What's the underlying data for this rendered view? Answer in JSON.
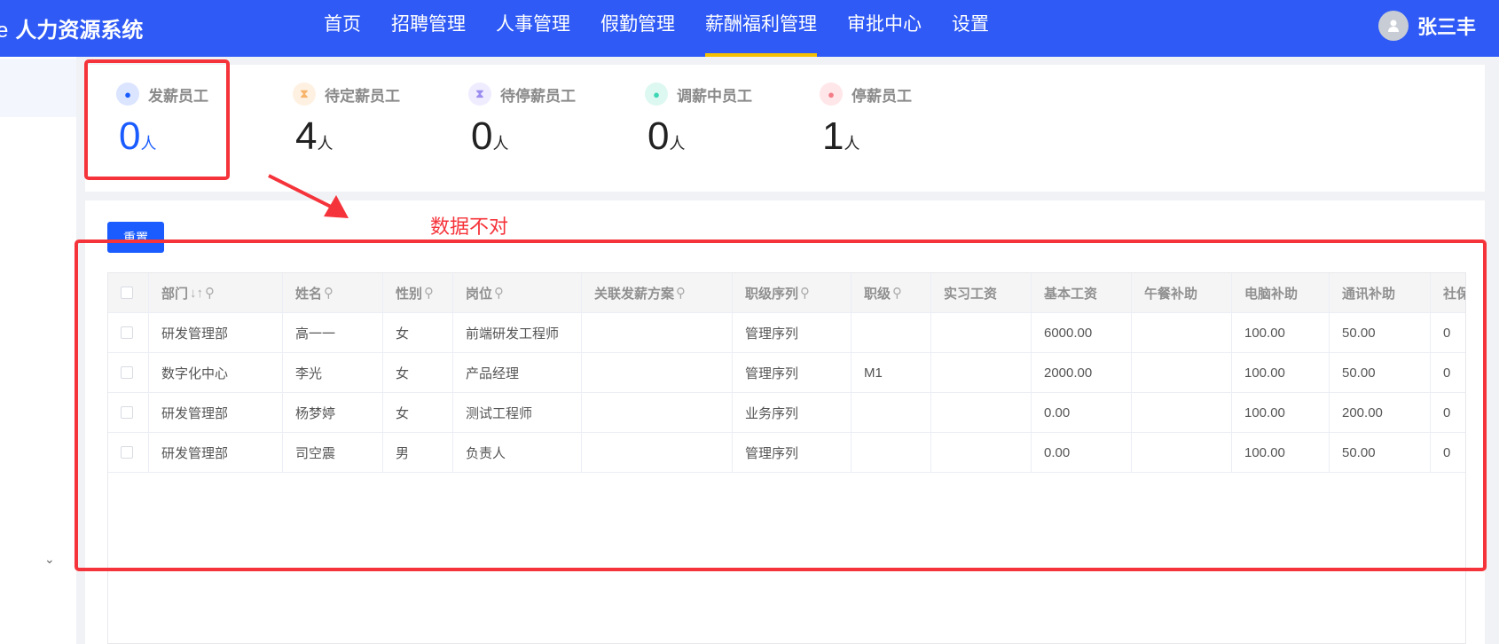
{
  "header": {
    "logo_prefix": "e",
    "title": "人力资源系统",
    "nav": [
      "首页",
      "招聘管理",
      "人事管理",
      "假勤管理",
      "薪酬福利管理",
      "审批中心",
      "设置"
    ],
    "active_nav": "薪酬福利管理",
    "user": "张三丰"
  },
  "stats": [
    {
      "label": "发薪员工",
      "value": "0",
      "unit": "人",
      "icon": "money-bag-icon",
      "color": "#1a5cff",
      "bg": "#dbe5ff"
    },
    {
      "label": "待定薪员工",
      "value": "4",
      "unit": "人",
      "icon": "hourglass-icon",
      "color": "#f7b36a",
      "bg": "#fff1e2"
    },
    {
      "label": "待停薪员工",
      "value": "0",
      "unit": "人",
      "icon": "hourglass-icon",
      "color": "#9b8cf0",
      "bg": "#efecff"
    },
    {
      "label": "调薪中员工",
      "value": "0",
      "unit": "人",
      "icon": "coins-icon",
      "color": "#3dd6b4",
      "bg": "#ddf8f1"
    },
    {
      "label": "停薪员工",
      "value": "1",
      "unit": "人",
      "icon": "money-bag-icon",
      "color": "#f27c88",
      "bg": "#ffe6e9"
    }
  ],
  "toolbar": {
    "reset_label": "重置"
  },
  "annotation": {
    "text": "数据不对"
  },
  "table": {
    "columns": [
      "部门",
      "姓名",
      "性别",
      "岗位",
      "关联发薪方案",
      "职级序列",
      "职级",
      "实习工资",
      "基本工资",
      "午餐补助",
      "电脑补助",
      "通讯补助",
      "社保"
    ],
    "rows": [
      [
        "研发管理部",
        "高一一",
        "女",
        "前端研发工程师",
        "",
        "管理序列",
        "",
        "",
        "6000.00",
        "",
        "100.00",
        "50.00",
        "0"
      ],
      [
        "数字化中心",
        "李光",
        "女",
        "产品经理",
        "",
        "管理序列",
        "M1",
        "",
        "2000.00",
        "",
        "100.00",
        "50.00",
        "0"
      ],
      [
        "研发管理部",
        "杨梦婷",
        "女",
        "测试工程师",
        "",
        "业务序列",
        "",
        "",
        "0.00",
        "",
        "100.00",
        "200.00",
        "0"
      ],
      [
        "研发管理部",
        "司空震",
        "男",
        "负责人",
        "",
        "管理序列",
        "",
        "",
        "0.00",
        "",
        "100.00",
        "50.00",
        "0"
      ]
    ]
  }
}
